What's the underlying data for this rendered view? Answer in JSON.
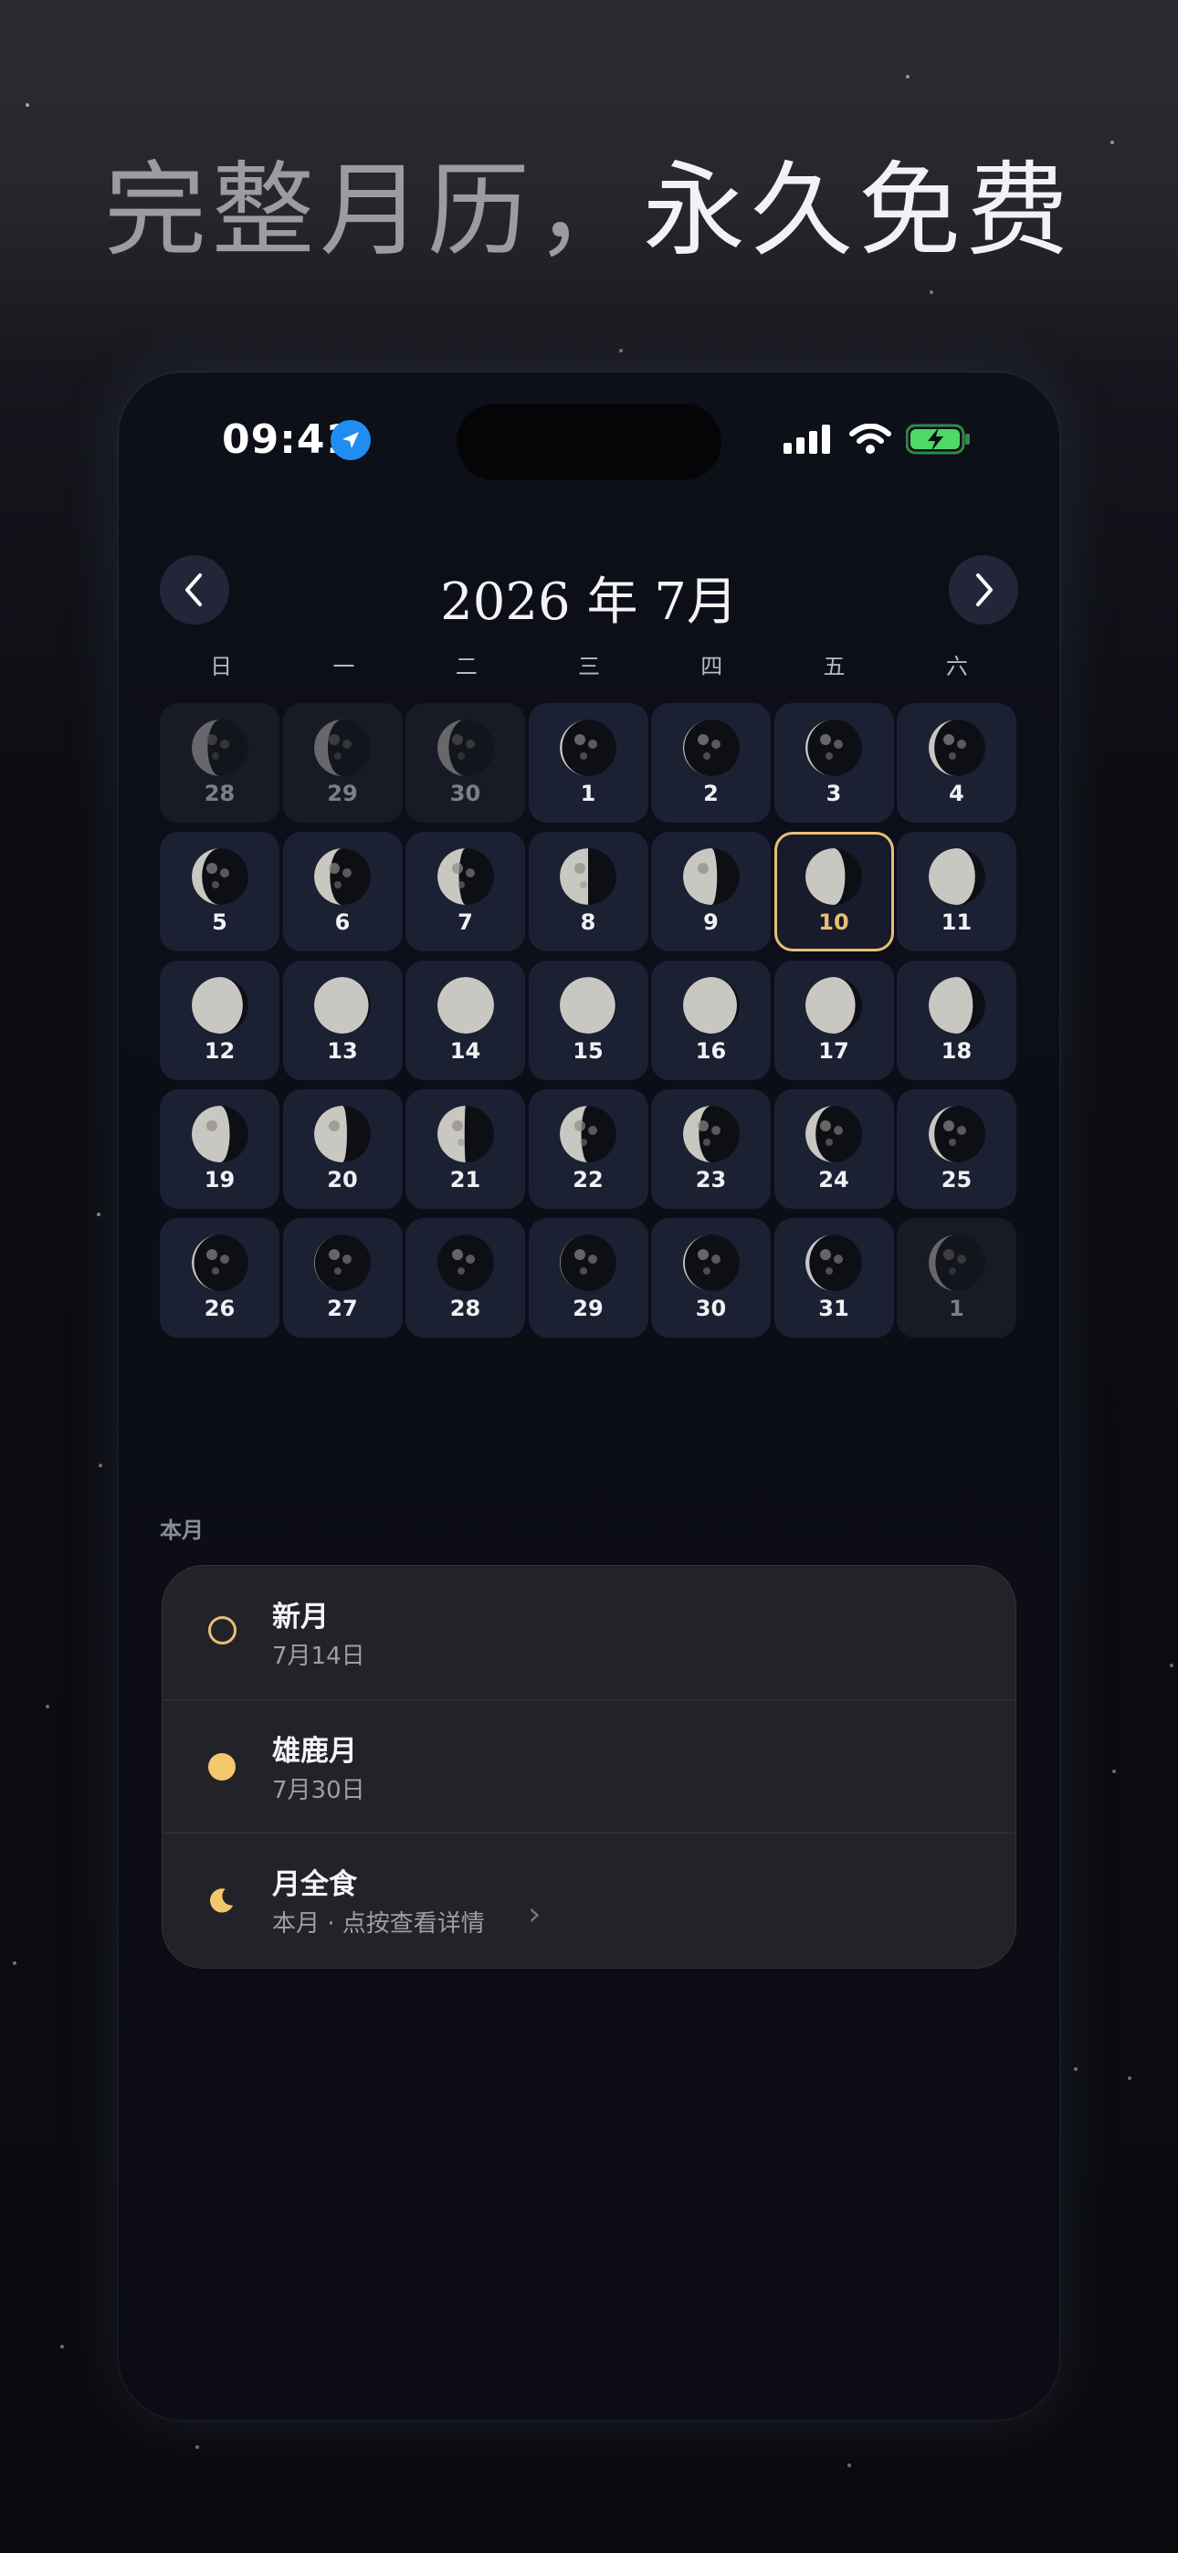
{
  "headline": {
    "dim": "完整月历，",
    "bright": "永久免费"
  },
  "status_bar": {
    "time": "09:41",
    "location_icon": "location-arrow-icon",
    "signal_icon": "cellular-signal-icon",
    "wifi_icon": "wifi-icon",
    "battery_icon": "battery-charging-icon"
  },
  "calendar": {
    "title": "2026 年 7月",
    "prev_icon": "chevron-left-icon",
    "next_icon": "chevron-right-icon",
    "weekdays": [
      "日",
      "一",
      "二",
      "三",
      "四",
      "五",
      "六"
    ],
    "days": [
      {
        "d": "28",
        "phase": 0.72,
        "other": true
      },
      {
        "d": "29",
        "phase": 0.76,
        "other": true
      },
      {
        "d": "30",
        "phase": 0.8,
        "other": true
      },
      {
        "d": "1",
        "phase": 0.96,
        "other": false
      },
      {
        "d": "2",
        "phase": 0.98,
        "other": false
      },
      {
        "d": "3",
        "phase": 0.96,
        "other": false
      },
      {
        "d": "4",
        "phase": 0.9,
        "other": false
      },
      {
        "d": "5",
        "phase": 0.82,
        "other": false
      },
      {
        "d": "6",
        "phase": 0.72,
        "other": false
      },
      {
        "d": "7",
        "phase": 0.62,
        "other": false
      },
      {
        "d": "8",
        "phase": 0.5,
        "other": false
      },
      {
        "d": "9",
        "phase": 0.4,
        "other": false
      },
      {
        "d": "10",
        "phase": 0.3,
        "other": false,
        "selected": true
      },
      {
        "d": "11",
        "phase": 0.18,
        "other": false
      },
      {
        "d": "12",
        "phase": 0.1,
        "other": false
      },
      {
        "d": "13",
        "phase": 0.04,
        "other": false
      },
      {
        "d": "14",
        "phase": 0.0,
        "other": false
      },
      {
        "d": "15",
        "phase": 0.02,
        "other": false
      },
      {
        "d": "16",
        "phase": 0.05,
        "other": false
      },
      {
        "d": "17",
        "phase": 0.12,
        "other": false
      },
      {
        "d": "18",
        "phase": 0.22,
        "other": false
      },
      {
        "d": "19",
        "phase": 0.33,
        "other": false
      },
      {
        "d": "20",
        "phase": 0.42,
        "other": false
      },
      {
        "d": "21",
        "phase": 0.52,
        "other": false
      },
      {
        "d": "22",
        "phase": 0.62,
        "other": false
      },
      {
        "d": "23",
        "phase": 0.72,
        "other": false
      },
      {
        "d": "24",
        "phase": 0.82,
        "other": false
      },
      {
        "d": "25",
        "phase": 0.9,
        "other": false
      },
      {
        "d": "26",
        "phase": 0.96,
        "other": false
      },
      {
        "d": "27",
        "phase": 0.99,
        "other": false
      },
      {
        "d": "28",
        "phase": 1.0,
        "other": false
      },
      {
        "d": "29",
        "phase": 0.99,
        "other": false
      },
      {
        "d": "30",
        "phase": 0.97,
        "other": false
      },
      {
        "d": "31",
        "phase": 0.93,
        "other": false
      },
      {
        "d": "1",
        "phase": 0.88,
        "other": true
      }
    ]
  },
  "this_month": {
    "label": "本月",
    "events": [
      {
        "title": "新月",
        "sub": "7月14日",
        "icon": "new-moon-ring-icon"
      },
      {
        "title": "雄鹿月",
        "sub": "7月30日",
        "icon": "full-moon-icon"
      },
      {
        "title": "月全食",
        "sub": "本月 · 点按查看详情",
        "icon": "crescent-moon-icon"
      }
    ]
  },
  "colors": {
    "accent_gold": "#e7bf77",
    "moon_surface": "#c9c7c2",
    "location_blue": "#1f8ef0",
    "battery_green": "#4cd964"
  }
}
